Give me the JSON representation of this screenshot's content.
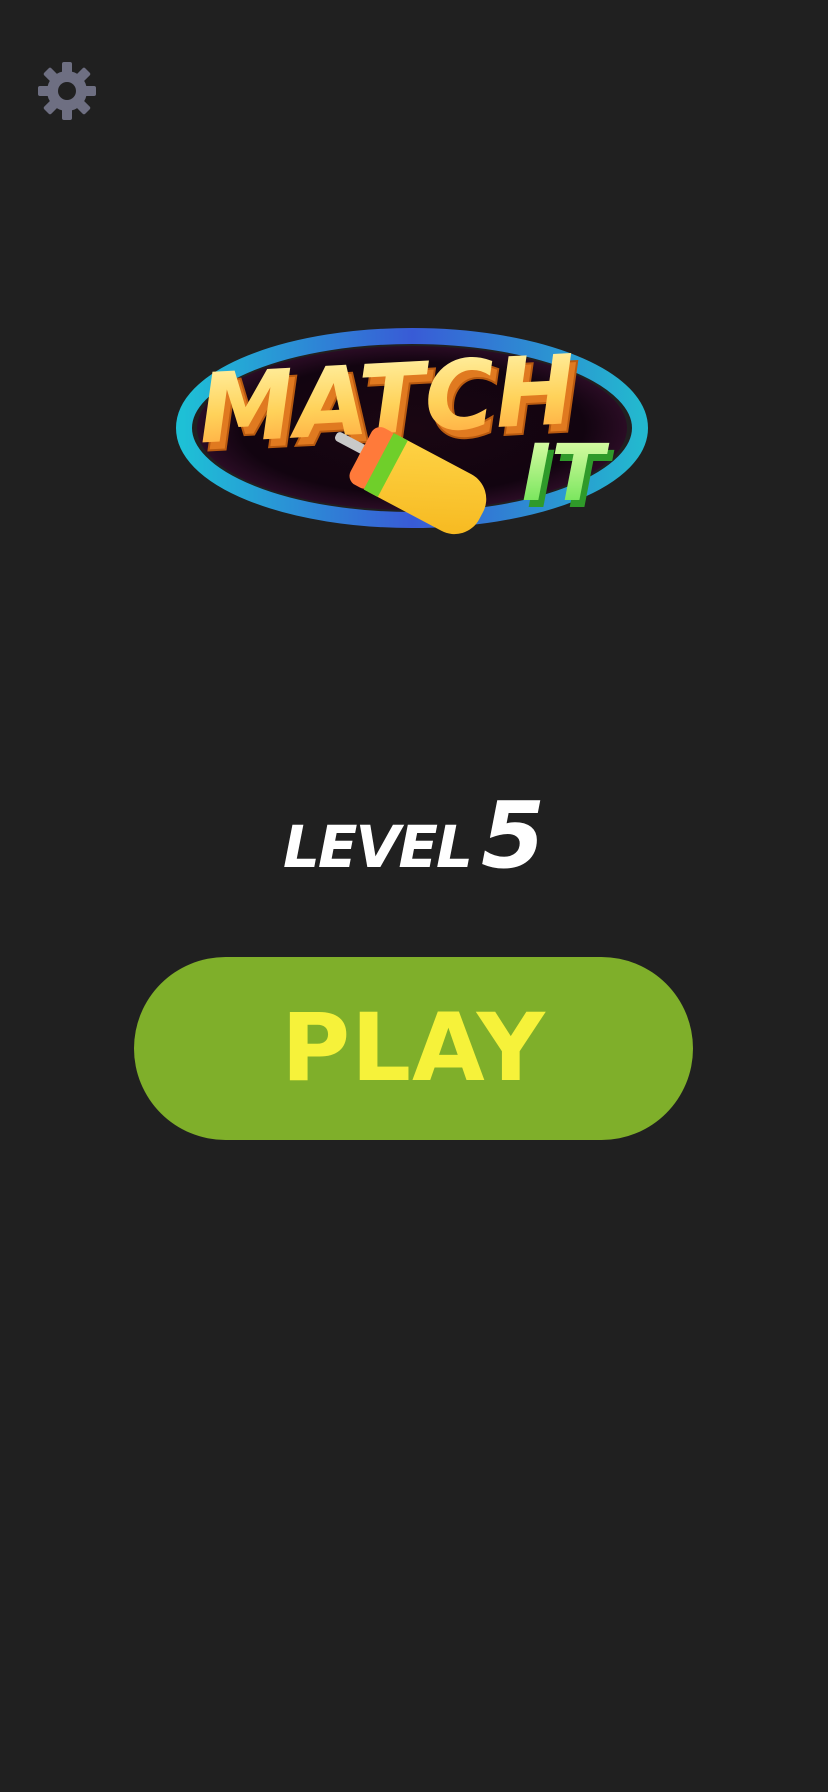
{
  "settings": {
    "icon": "gear-icon"
  },
  "logo": {
    "line1": "MATCH",
    "line2": "IT"
  },
  "level": {
    "label": "LEVEL",
    "number": "5"
  },
  "play": {
    "label": "PLAY"
  },
  "colors": {
    "background": "#202020",
    "play_button": "#7faf2a",
    "play_text": "#f6f23a",
    "gear": "#6e6f82"
  }
}
